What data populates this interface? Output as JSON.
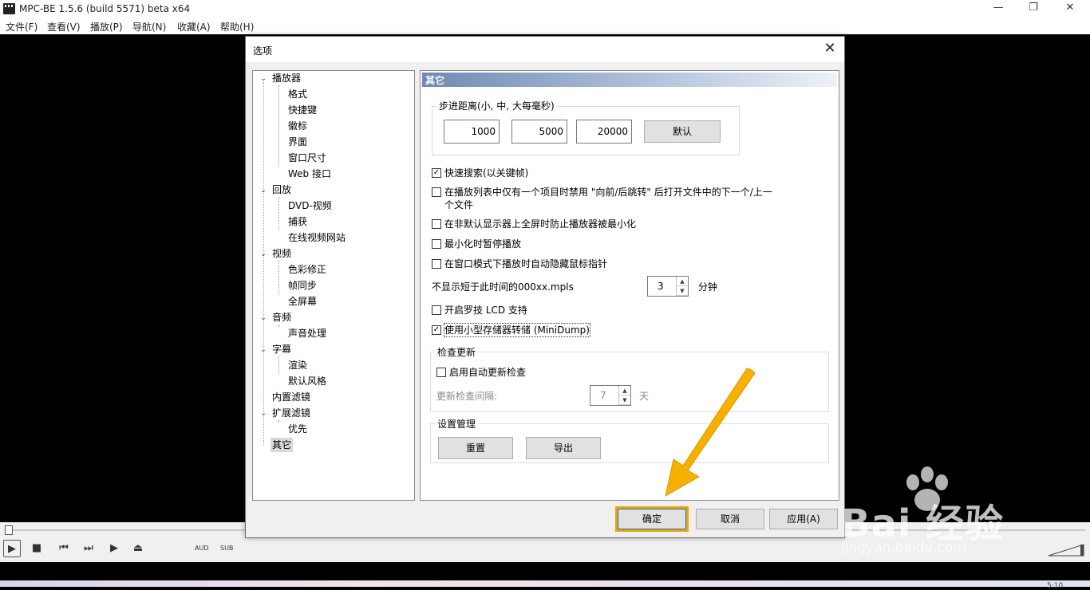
{
  "window": {
    "title": "MPC-BE 1.5.6 (build 5571) beta x64",
    "minimize_glyph": "—",
    "maximize_glyph": "❐",
    "close_glyph": "✕"
  },
  "menubar": [
    "文件(F)",
    "查看(V)",
    "播放(P)",
    "导航(N)",
    "收藏(A)",
    "帮助(H)"
  ],
  "dialog": {
    "title": "选项",
    "close_glyph": "✕",
    "tree": {
      "player": {
        "label": "播放器",
        "children": [
          "格式",
          "快捷键",
          "徽标",
          "界面",
          "窗口尺寸",
          "Web 接口"
        ]
      },
      "playback": {
        "label": "回放",
        "children": [
          "DVD-视频",
          "捕获",
          "在线视频网站"
        ]
      },
      "video": {
        "label": "视频",
        "children": [
          "色彩修正",
          "帧同步",
          "全屏幕"
        ]
      },
      "audio": {
        "label": "音频",
        "children": [
          "声音处理"
        ]
      },
      "subtitles": {
        "label": "字幕",
        "children": [
          "渲染",
          "默认风格"
        ]
      },
      "internal_filters": "内置滤镜",
      "external_filters": {
        "label": "扩展滤镜",
        "children": [
          "优先"
        ]
      },
      "misc": "其它"
    },
    "panel": {
      "header": "其它",
      "step": {
        "group_label": "步进距离(小, 中, 大每毫秒)",
        "small": "1000",
        "medium": "5000",
        "large": "20000",
        "default_button": "默认"
      },
      "options": {
        "fast_seek": {
          "label": "快速搜索(以关键帧)",
          "checked": true
        },
        "disable_prev_next_line1": "在播放列表中仅有一个项目时禁用 \"向前/后跳转\" 后打开文件中的下一个/上一",
        "disable_prev_next_line2": "个文件",
        "prevent_minimize": "在非默认显示器上全屏时防止播放器被最小化",
        "pause_minimized": "最小化时暂停播放",
        "hide_cursor": "在窗口模式下播放时自动隐藏鼠标指针",
        "mpls_label": "不显示短于此时间的000xx.mpls",
        "mpls_value": "3",
        "mpls_unit": "分钟",
        "logitech_lcd": "开启罗技 LCD 支持",
        "minidump": {
          "label": "使用小型存储器转储 (MiniDump)",
          "checked": true
        }
      },
      "updates": {
        "group_label": "检查更新",
        "auto_check": "启用自动更新检查",
        "interval_label": "更新检查间隔:",
        "interval_value": "7",
        "interval_unit": "天"
      },
      "settings": {
        "group_label": "设置管理",
        "reset_button": "重置",
        "export_button": "导出"
      }
    },
    "buttons": {
      "ok": "确定",
      "cancel": "取消",
      "apply": "应用(A)"
    }
  },
  "player_controls": {
    "aud": "AUD",
    "sub": "SUB"
  },
  "status": {
    "clock_fragment": "5:10"
  },
  "watermark": {
    "text": "Bai 经验",
    "url": "jingyan.baidu.com"
  },
  "colors": {
    "highlight": "#f5a300",
    "header_blue": "#6f8ab6"
  }
}
